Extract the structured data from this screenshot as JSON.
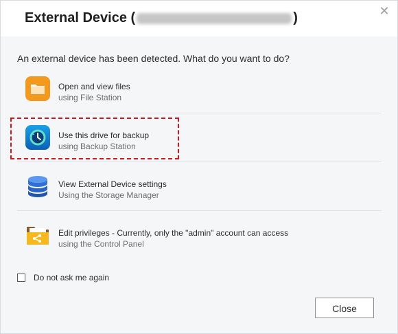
{
  "dialog": {
    "title_prefix": "External Device (",
    "title_suffix": ")",
    "close_icon_glyph": "✕",
    "prompt": "An external device has been detected. What do you want to do?"
  },
  "options": [
    {
      "icon": "folder-icon",
      "title": "Open and view files",
      "subtitle": "using File Station"
    },
    {
      "icon": "backup-clock-icon",
      "title": "Use this drive for backup",
      "subtitle": "using Backup Station",
      "highlighted": true
    },
    {
      "icon": "database-icon",
      "title": "View External Device settings",
      "subtitle": "Using the Storage Manager"
    },
    {
      "icon": "shared-folder-icon",
      "title": "Edit privileges - Currently, only the \"admin\" account can access",
      "subtitle": "using the Control Panel"
    }
  ],
  "footer": {
    "checkbox_label": "Do not ask me again",
    "checkbox_checked": false,
    "close_button": "Close"
  },
  "colors": {
    "highlight_border": "#d1161b",
    "folder_orange": "#f39a1e",
    "backup_blue": "#1a7fd4",
    "storage_blue": "#2f6fd6",
    "shared_folder_yellow": "#f6b81c"
  }
}
